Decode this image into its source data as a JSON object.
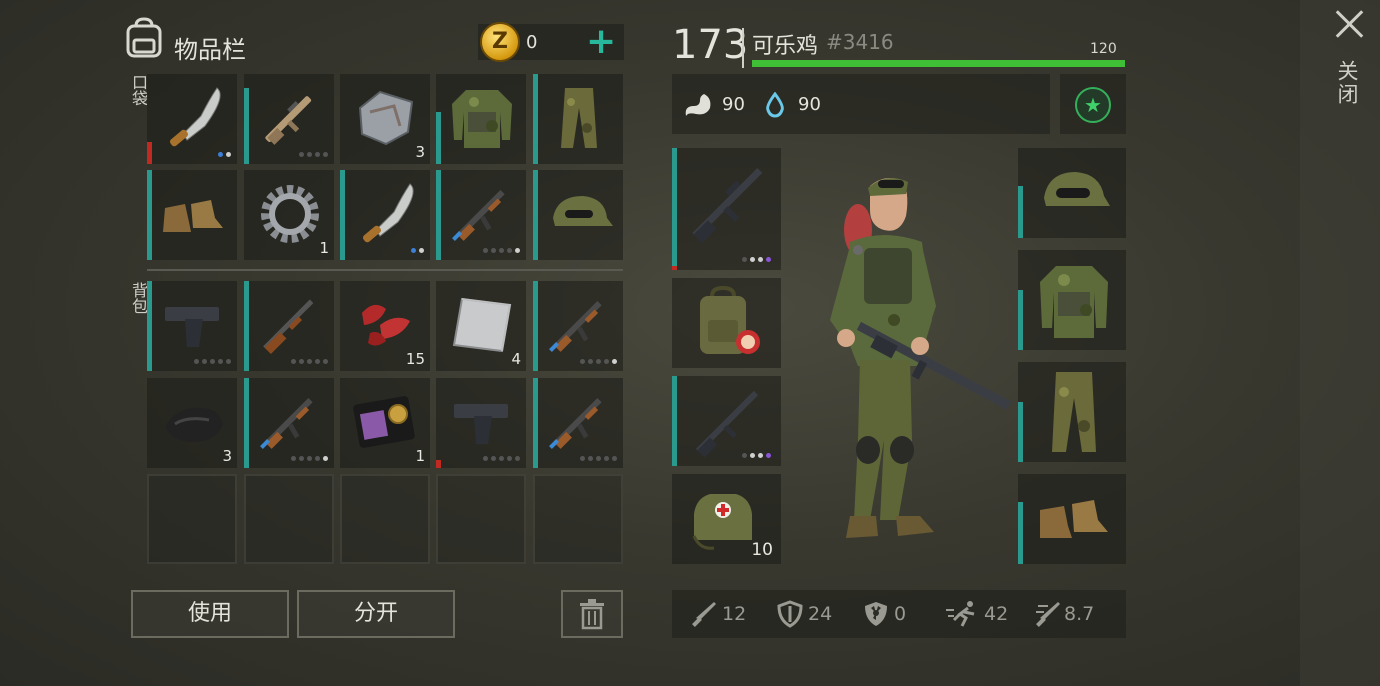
{
  "close": {
    "label": "关闭"
  },
  "inventory": {
    "title": "物品栏",
    "coins": "0",
    "plus": "+",
    "pocket_label": "口袋",
    "backpack_label": "背包",
    "pocket": [
      {
        "icon": "machete-icon",
        "count": ""
      },
      {
        "icon": "assault-rifle-icon",
        "count": ""
      },
      {
        "icon": "metal-plate-icon",
        "count": "3"
      },
      {
        "icon": "camo-jacket-icon",
        "count": ""
      },
      {
        "icon": "camo-pants-icon",
        "count": ""
      },
      {
        "icon": "boots-icon",
        "count": ""
      },
      {
        "icon": "gear-icon",
        "count": "1"
      },
      {
        "icon": "machete-icon",
        "count": ""
      },
      {
        "icon": "ak-rifle-icon",
        "count": ""
      },
      {
        "icon": "camo-cap-icon",
        "count": ""
      }
    ],
    "backpack": [
      {
        "icon": "pistol-icon",
        "count": ""
      },
      {
        "icon": "shotgun-icon",
        "count": ""
      },
      {
        "icon": "raw-meat-icon",
        "count": "15"
      },
      {
        "icon": "steel-sheet-icon",
        "count": "4"
      },
      {
        "icon": "ak-rifle-icon",
        "count": ""
      },
      {
        "icon": "cloth-icon",
        "count": "3"
      },
      {
        "icon": "ak-rifle-icon",
        "count": ""
      },
      {
        "icon": "police-badge-icon",
        "count": "1"
      },
      {
        "icon": "pistol-icon",
        "count": ""
      },
      {
        "icon": "ak-rifle-icon",
        "count": ""
      }
    ],
    "use_button": "使用",
    "split_button": "分开"
  },
  "player": {
    "level": "173",
    "name": "可乐鸡",
    "id": "#3416",
    "xp_label": "120",
    "xp_fraction": 1.0,
    "food": "90",
    "water": "90",
    "medkit_count": "10"
  },
  "stats": [
    {
      "icon": "damage-icon",
      "value": "12"
    },
    {
      "icon": "armor-icon",
      "value": "24"
    },
    {
      "icon": "radiation-icon",
      "value": "0"
    },
    {
      "icon": "speed-icon",
      "value": "42"
    },
    {
      "icon": "attack-speed-icon",
      "value": "8.7"
    }
  ],
  "colors": {
    "accent": "#27b79a",
    "xp": "#3ebf36",
    "durability_low": "#c02a20"
  }
}
